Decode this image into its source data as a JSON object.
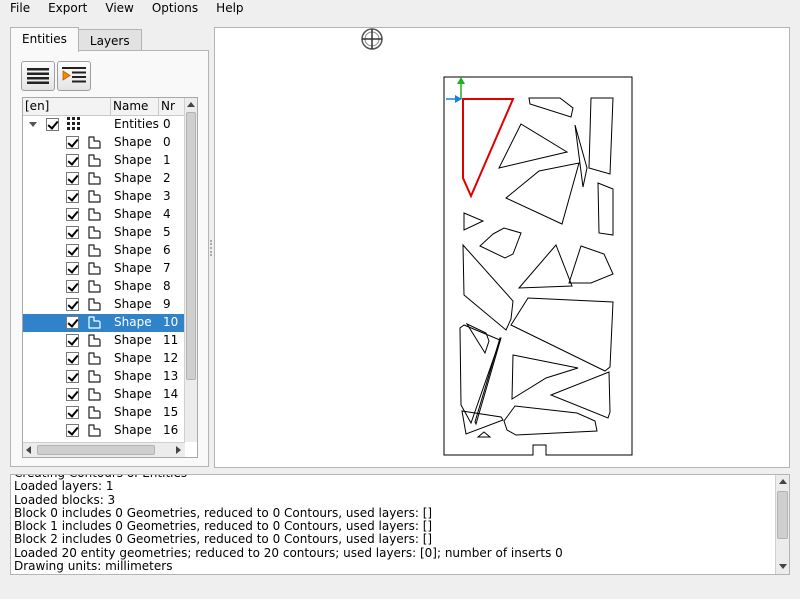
{
  "menu": [
    "File",
    "Export",
    "View",
    "Options",
    "Help"
  ],
  "tabs": [
    "Entities",
    "Layers"
  ],
  "tree": {
    "headers": [
      "[en]",
      "Name",
      "Nr"
    ],
    "root": {
      "name": "Entities",
      "nr": "0"
    },
    "rows": [
      {
        "name": "Shape",
        "nr": "0"
      },
      {
        "name": "Shape",
        "nr": "1"
      },
      {
        "name": "Shape",
        "nr": "2"
      },
      {
        "name": "Shape",
        "nr": "3"
      },
      {
        "name": "Shape",
        "nr": "4"
      },
      {
        "name": "Shape",
        "nr": "5"
      },
      {
        "name": "Shape",
        "nr": "6"
      },
      {
        "name": "Shape",
        "nr": "7"
      },
      {
        "name": "Shape",
        "nr": "8"
      },
      {
        "name": "Shape",
        "nr": "9"
      },
      {
        "name": "Shape",
        "nr": "10"
      },
      {
        "name": "Shape",
        "nr": "11"
      },
      {
        "name": "Shape",
        "nr": "12"
      },
      {
        "name": "Shape",
        "nr": "13"
      },
      {
        "name": "Shape",
        "nr": "14"
      },
      {
        "name": "Shape",
        "nr": "15"
      },
      {
        "name": "Shape",
        "nr": "16"
      }
    ],
    "selected_nr": "10",
    "selection_color": "#3083c8"
  },
  "log": {
    "lines": [
      "Creating Contours of Entities",
      "Loaded layers: 1",
      "Loaded blocks: 3",
      "Block 0 includes 0 Geometries, reduced to 0 Contours, used layers: []",
      "Block 1 includes 0 Geometries, reduced to 0 Contours, used layers: []",
      "Block 2 includes 0 Geometries, reduced to 0 Contours, used layers: []",
      "Loaded 20 entity geometries; reduced to 20 contours; used layers: [0]; number of inserts 0",
      "Drawing units: millimeters"
    ]
  },
  "colors": {
    "selected_contour": "#e00000",
    "axis_x": "#1a7fe0",
    "axis_y": "#1bb31b"
  }
}
